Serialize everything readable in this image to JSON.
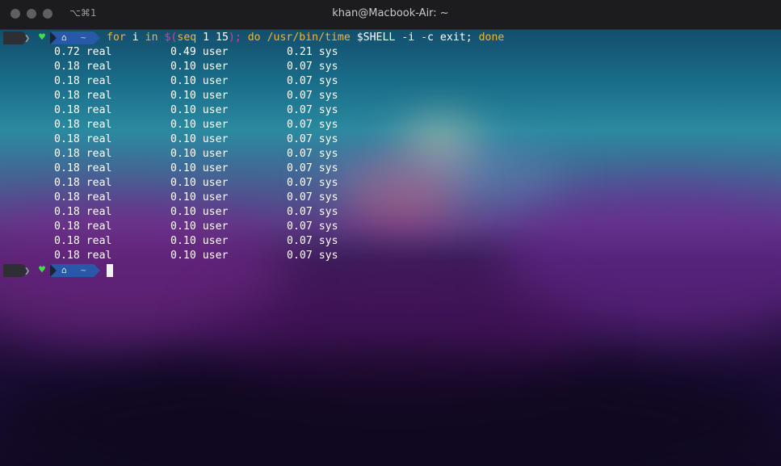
{
  "window": {
    "title": "khan@Macbook-Air: ~",
    "shortcut": "⌥⌘1"
  },
  "prompt": {
    "apple_glyph": "",
    "separator": "❯",
    "heart_glyph": "♥",
    "home_glyph": "⌂",
    "dir": "~",
    "colors": {
      "apple_bg": "#2d2f33",
      "dir_bg": "#2858a8",
      "heart": "#41e04a"
    }
  },
  "command": {
    "for": "for",
    "var": " i ",
    "in": "in",
    "subst_open": " $(",
    "seq": "seq",
    "seq_args": " 1 15",
    "subst_close": ");",
    "do": " do",
    "path": " /usr/bin/time",
    "rest": " $SHELL -i -c exit;",
    "done": " done"
  },
  "syntax_colors": {
    "keyword": "#f2b33d",
    "subst": "#e8359a",
    "text": "#ffffff"
  },
  "output": [
    {
      "real": "0.72 real",
      "user": "0.49 user",
      "sys": "0.21 sys"
    },
    {
      "real": "0.18 real",
      "user": "0.10 user",
      "sys": "0.07 sys"
    },
    {
      "real": "0.18 real",
      "user": "0.10 user",
      "sys": "0.07 sys"
    },
    {
      "real": "0.18 real",
      "user": "0.10 user",
      "sys": "0.07 sys"
    },
    {
      "real": "0.18 real",
      "user": "0.10 user",
      "sys": "0.07 sys"
    },
    {
      "real": "0.18 real",
      "user": "0.10 user",
      "sys": "0.07 sys"
    },
    {
      "real": "0.18 real",
      "user": "0.10 user",
      "sys": "0.07 sys"
    },
    {
      "real": "0.18 real",
      "user": "0.10 user",
      "sys": "0.07 sys"
    },
    {
      "real": "0.18 real",
      "user": "0.10 user",
      "sys": "0.07 sys"
    },
    {
      "real": "0.18 real",
      "user": "0.10 user",
      "sys": "0.07 sys"
    },
    {
      "real": "0.18 real",
      "user": "0.10 user",
      "sys": "0.07 sys"
    },
    {
      "real": "0.18 real",
      "user": "0.10 user",
      "sys": "0.07 sys"
    },
    {
      "real": "0.18 real",
      "user": "0.10 user",
      "sys": "0.07 sys"
    },
    {
      "real": "0.18 real",
      "user": "0.10 user",
      "sys": "0.07 sys"
    },
    {
      "real": "0.18 real",
      "user": "0.10 user",
      "sys": "0.07 sys"
    }
  ]
}
